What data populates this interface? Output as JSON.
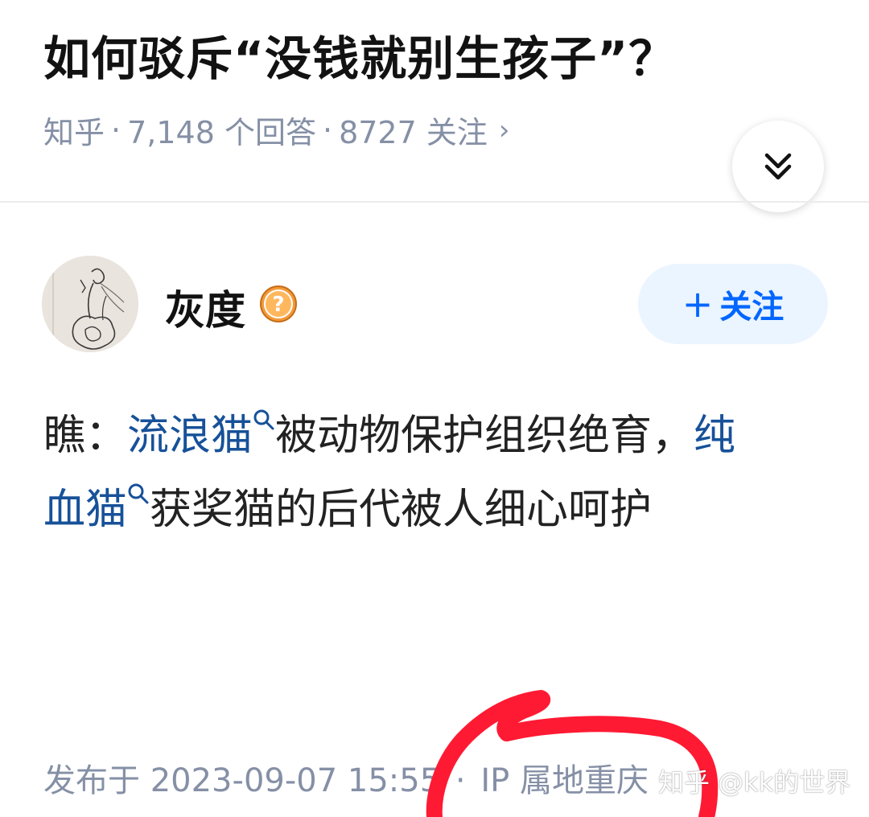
{
  "question": {
    "title": "如何驳斥“没钱就别生孩子”？",
    "source": "知乎",
    "separator": "·",
    "answers": "7,148 个回答",
    "followers": "8727 关注",
    "chevron": "›"
  },
  "author": {
    "name": "灰度",
    "badge_glyph": "?",
    "follow_plus": "+",
    "follow_label": "关注"
  },
  "answer": {
    "line1_prefix": "瞧：",
    "line1_link1": "流浪猫",
    "line1_middle": "被动物保护组织绝育，",
    "line1_link2_part1": "纯",
    "line2_link2_part2": "血猫",
    "line2_suffix": "获奖猫的后代被人细心呵护"
  },
  "footer": {
    "published": "发布于 2023-09-07 15:55",
    "separator": "·",
    "ip": "IP 属地重庆"
  },
  "watermark": "知乎 @kk的世界",
  "colors": {
    "title": "#121212",
    "meta": "#8590a6",
    "link": "#175199",
    "follow_bg": "#ebf5ff",
    "follow_text": "#0066ff",
    "badge": "#f29a3a",
    "annotation": "#ff1a33"
  },
  "icons": {
    "collapse": "double-chevron-down-icon",
    "badge": "question-badge-icon",
    "link_search": "search-icon"
  }
}
